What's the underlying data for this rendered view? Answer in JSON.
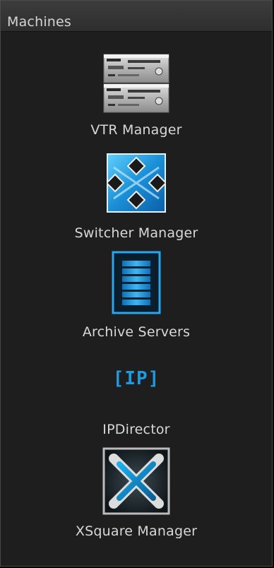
{
  "panel": {
    "title": "Machines"
  },
  "items": [
    {
      "label": "VTR Manager",
      "icon": "vtr-rack-icon"
    },
    {
      "label": "Switcher Manager",
      "icon": "switcher-diamond-icon"
    },
    {
      "label": "Archive Servers",
      "icon": "archive-server-icon"
    },
    {
      "label": "IPDirector",
      "icon": "ip-logo-icon",
      "icon_text": "[IP]"
    },
    {
      "label": "XSquare Manager",
      "icon": "xsquare-icon"
    }
  ],
  "colors": {
    "panel_bg": "#1e1e1e",
    "header_bg": "#343434",
    "text": "#d8d8d8",
    "accent_blue": "#1e9ae0"
  }
}
